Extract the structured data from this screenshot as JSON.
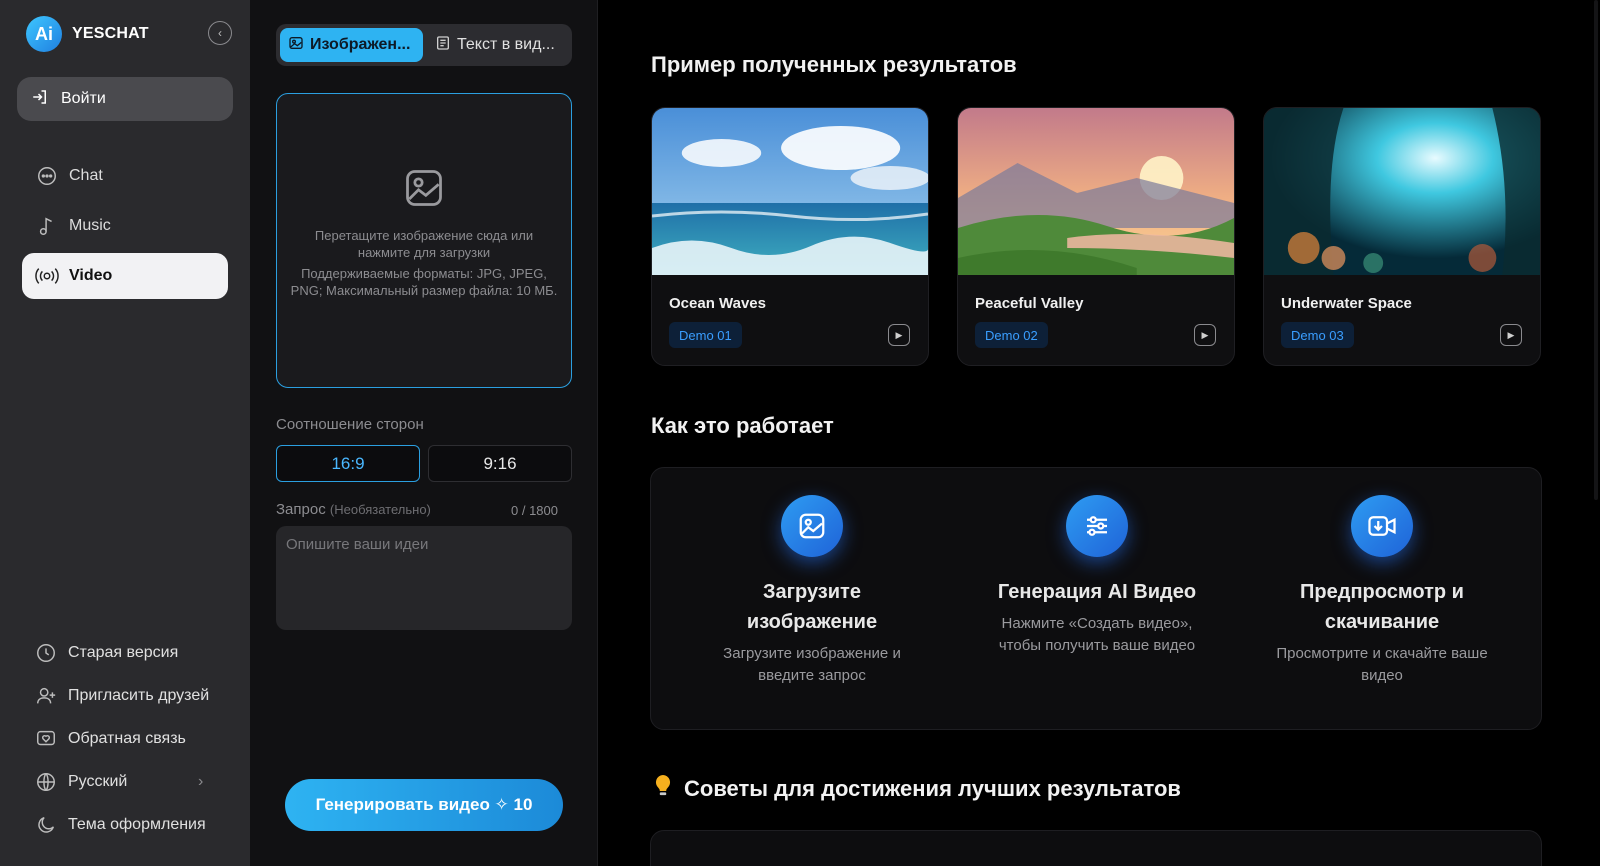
{
  "sidebar": {
    "brand": "YESCHAT",
    "login": "Войти",
    "items": [
      {
        "label": "Chat",
        "icon": "chat-bubble-icon"
      },
      {
        "label": "Music",
        "icon": "music-note-icon"
      },
      {
        "label": "Video",
        "icon": "video-broadcast-icon"
      }
    ],
    "bottom": [
      {
        "label": "Старая версия",
        "icon": "history-icon"
      },
      {
        "label": "Пригласить друзей",
        "icon": "add-user-icon"
      },
      {
        "label": "Обратная связь",
        "icon": "feedback-icon"
      },
      {
        "label": "Русский",
        "icon": "globe-icon"
      },
      {
        "label": "Тема оформления",
        "icon": "moon-icon"
      }
    ]
  },
  "panel": {
    "tabs": [
      "Изображен...",
      "Текст в вид..."
    ],
    "upload": {
      "line1": "Перетащите изображение сюда или нажмите для загрузки",
      "line2": "Поддерживаемые форматы: JPG, JPEG, PNG; Максимальный размер файла: 10 МБ."
    },
    "aspect_label": "Соотношение сторон",
    "ratios": [
      "16:9",
      "9:16"
    ],
    "prompt_label": "Запрос",
    "prompt_optional": "(Необязательно)",
    "prompt_count": "0 / 1800",
    "prompt_placeholder": "Опишите ваши идеи",
    "generate": "Генерировать видео ✧ 10"
  },
  "main": {
    "results_title": "Пример полученных результатов",
    "cards": [
      {
        "title": "Ocean Waves",
        "badge": "Demo 01"
      },
      {
        "title": "Peaceful Valley",
        "badge": "Demo 02"
      },
      {
        "title": "Underwater Space",
        "badge": "Demo 03"
      }
    ],
    "how_title": "Как это работает",
    "steps": [
      {
        "title": "Загрузите изображение",
        "desc": "Загрузите изображение и введите запрос",
        "icon": "image-upload-icon"
      },
      {
        "title": "Генерация AI Видео",
        "desc": "Нажмите «Создать видео», чтобы получить ваше видео",
        "icon": "sliders-icon"
      },
      {
        "title": "Предпросмотр и скачивание",
        "desc": "Просмотрите и скачайте ваше видео",
        "icon": "video-download-icon"
      }
    ],
    "tips_title": "Советы для достижения лучших результатов"
  },
  "colors": {
    "accent": "#2eb3f2",
    "badge_text": "#3a9eff"
  }
}
